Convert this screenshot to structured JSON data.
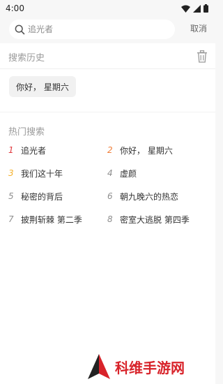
{
  "status_bar": {
    "time": "4:00"
  },
  "search": {
    "placeholder": "追光者",
    "cancel_label": "取消"
  },
  "history": {
    "title": "搜索历史",
    "items": [
      {
        "label": "你好， 星期六"
      }
    ]
  },
  "hot": {
    "title": "热门搜索",
    "items": [
      {
        "rank": "1",
        "label": "追光者",
        "rank_color": "#e0393e"
      },
      {
        "rank": "2",
        "label": "你好， 星期六",
        "rank_color": "#f0803c"
      },
      {
        "rank": "3",
        "label": "我们这十年",
        "rank_color": "#f5b12c"
      },
      {
        "rank": "4",
        "label": "虚颜",
        "rank_color": "#8e8e8e"
      },
      {
        "rank": "5",
        "label": "秘密的背后",
        "rank_color": "#8e8e8e"
      },
      {
        "rank": "6",
        "label": "朝九晚六的热恋",
        "rank_color": "#8e8e8e"
      },
      {
        "rank": "7",
        "label": "披荆斩棘 第二季",
        "rank_color": "#8e8e8e"
      },
      {
        "rank": "8",
        "label": "密室大逃脱 第四季",
        "rank_color": "#8e8e8e"
      }
    ]
  },
  "watermark": {
    "text": "科维手游网"
  },
  "icons": {
    "search": "search-icon",
    "trash": "trash-icon",
    "wifi": "wifi-icon",
    "signal": "signal-icon",
    "battery": "battery-icon"
  }
}
